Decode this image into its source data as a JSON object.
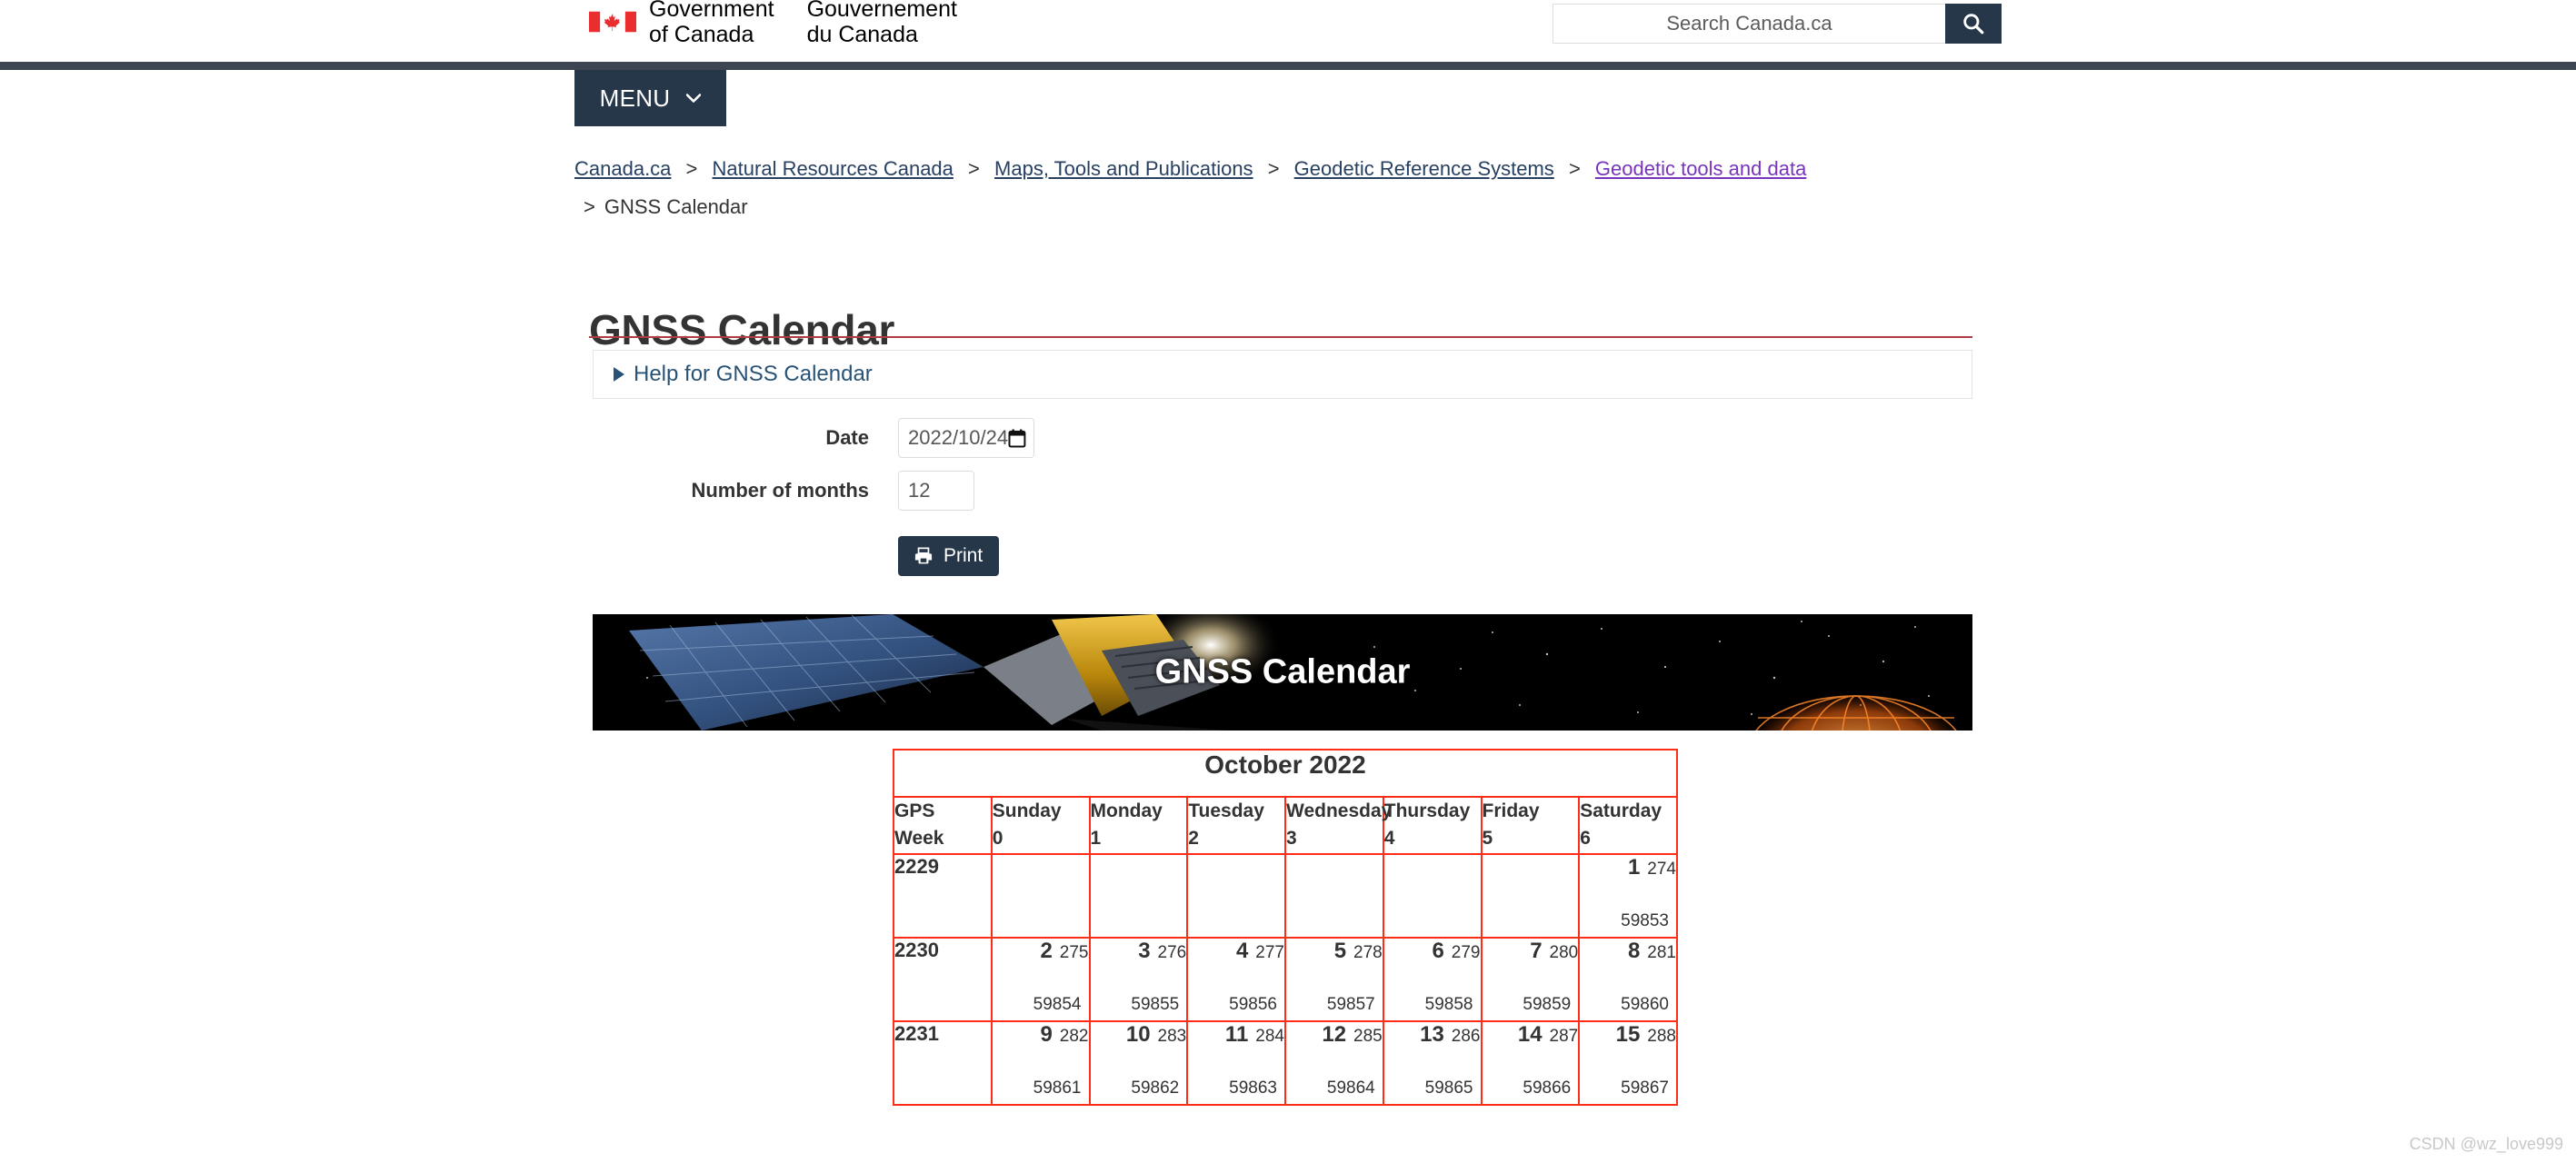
{
  "header": {
    "brand_en_line1": "Government",
    "brand_en_line2": "of Canada",
    "brand_fr_line1": "Gouvernement",
    "brand_fr_line2": "du Canada",
    "flag_alt": "canada-flag",
    "search_placeholder": "Search Canada.ca",
    "search_value": "",
    "search_button_label": "search-icon",
    "menu_label": "MENU"
  },
  "breadcrumb": {
    "items": [
      {
        "label": "Canada.ca",
        "visited": false
      },
      {
        "label": "Natural Resources Canada",
        "visited": false
      },
      {
        "label": "Maps, Tools and Publications",
        "visited": false
      },
      {
        "label": "Geodetic Reference Systems",
        "visited": false
      },
      {
        "label": "Geodetic tools and data",
        "visited": true
      }
    ],
    "separator": ">",
    "current": "GNSS Calendar"
  },
  "main": {
    "page_title": "GNSS Calendar",
    "help_label": "Help for GNSS Calendar",
    "form": {
      "date_label": "Date",
      "date_value": "2022/10/24",
      "months_label": "Number of months",
      "months_value": "12",
      "print_label": "Print"
    },
    "banner": {
      "title": "GNSS Calendar"
    }
  },
  "calendar": {
    "month_title": "October 2022",
    "week_header_line1": "GPS",
    "week_header_line2": "Week",
    "day_headers": [
      {
        "name": "Sunday",
        "index": "0"
      },
      {
        "name": "Monday",
        "index": "1"
      },
      {
        "name": "Tuesday",
        "index": "2"
      },
      {
        "name": "Wednesday",
        "index": "3"
      },
      {
        "name": "Thursday",
        "index": "4"
      },
      {
        "name": "Friday",
        "index": "5"
      },
      {
        "name": "Saturday",
        "index": "6"
      }
    ],
    "rows": [
      {
        "gps_week": "2229",
        "days": [
          null,
          null,
          null,
          null,
          null,
          null,
          {
            "day": "1",
            "doy": "274",
            "mjd": "59853"
          }
        ]
      },
      {
        "gps_week": "2230",
        "days": [
          {
            "day": "2",
            "doy": "275",
            "mjd": "59854"
          },
          {
            "day": "3",
            "doy": "276",
            "mjd": "59855"
          },
          {
            "day": "4",
            "doy": "277",
            "mjd": "59856"
          },
          {
            "day": "5",
            "doy": "278",
            "mjd": "59857"
          },
          {
            "day": "6",
            "doy": "279",
            "mjd": "59858"
          },
          {
            "day": "7",
            "doy": "280",
            "mjd": "59859"
          },
          {
            "day": "8",
            "doy": "281",
            "mjd": "59860"
          }
        ]
      },
      {
        "gps_week": "2231",
        "days": [
          {
            "day": "9",
            "doy": "282",
            "mjd": "59861"
          },
          {
            "day": "10",
            "doy": "283",
            "mjd": "59862"
          },
          {
            "day": "11",
            "doy": "284",
            "mjd": "59863"
          },
          {
            "day": "12",
            "doy": "285",
            "mjd": "59864"
          },
          {
            "day": "13",
            "doy": "286",
            "mjd": "59865"
          },
          {
            "day": "14",
            "doy": "287",
            "mjd": "59866"
          },
          {
            "day": "15",
            "doy": "288",
            "mjd": "59867"
          }
        ]
      }
    ]
  },
  "watermark": "CSDN @wz_love999",
  "colors": {
    "nav_dark": "#26374a",
    "strip": "#3d4452",
    "title_rule": "#af3c43",
    "table_border": "#ff2d18",
    "link": "#284162",
    "link_visited": "#7834bc"
  }
}
